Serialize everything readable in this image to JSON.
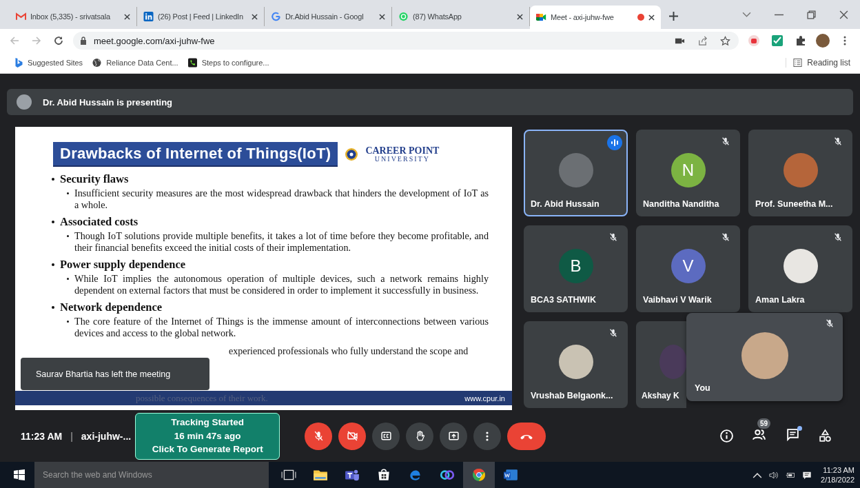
{
  "browser": {
    "tabs": [
      {
        "title": "Inbox (5,335) - srivatsala",
        "selected": false
      },
      {
        "title": "(26) Post | Feed | LinkedIn",
        "selected": false
      },
      {
        "title": "Dr.Abid Hussain - Googl",
        "selected": false
      },
      {
        "title": "(87) WhatsApp",
        "selected": false
      },
      {
        "title": "Meet - axi-juhw-fwe",
        "selected": true,
        "recording": true
      }
    ],
    "url": "meet.google.com/axi-juhw-fwe",
    "bookmarks": [
      {
        "label": "Suggested Sites"
      },
      {
        "label": "Reliance Data Cent..."
      },
      {
        "label": "Steps to configure..."
      }
    ],
    "reading_list": "Reading list"
  },
  "meet": {
    "presenter": "Dr. Abid Hussain is presenting",
    "slide": {
      "title": "Drawbacks of Internet of Things(IoT)",
      "logo": [
        "CAREER POINT",
        "UNIVERSITY"
      ],
      "sections": [
        {
          "heading": "Security flaws",
          "body": "Insufficient security measures are the most widespread drawback that hinders the development of IoT as a whole."
        },
        {
          "heading": "Associated costs",
          "body": "Though IoT solutions provide multiple benefits, it takes a lot of time before they become profitable, and their financial benefits exceed the initial costs of their implementation."
        },
        {
          "heading": "Power supply dependence",
          "body": "While IoT implies the autonomous operation of multiple devices, such a network remains highly dependent on external factors that must be considered in order to implement it successfully in business."
        },
        {
          "heading": "Network dependence",
          "body": "The core feature of the Internet of Things is the immense amount of interconnections between various devices and access to the global network."
        }
      ],
      "tail": "experienced professionals who fully understand the scope and",
      "footer_text": "possible consequences of their work.",
      "url": "www.cpur.in"
    },
    "toast": "Saurav Bhartia has left the meeting",
    "participants": [
      {
        "name": "Dr. Abid Hussain",
        "color": "#6b6f73",
        "speaking": true
      },
      {
        "name": "Nanditha Nanditha",
        "letter": "N",
        "color": "#7cb342",
        "muted": true,
        "speaking": false
      },
      {
        "name": "Prof. Suneetha M...",
        "color": "#b5653a",
        "muted": true,
        "speaking": false
      },
      {
        "name": "BCA3 SATHWIK",
        "letter": "B",
        "color": "#0f5a45",
        "muted": true,
        "speaking": false
      },
      {
        "name": "Vaibhavi V Warik",
        "letter": "V",
        "color": "#5c6bc0",
        "muted": true,
        "speaking": false
      },
      {
        "name": "Aman Lakra",
        "color": "#e8e6e2",
        "muted": true,
        "speaking": false
      },
      {
        "name": "Vrushab Belgaonk...",
        "color": "#c9c2b3",
        "muted": true,
        "speaking": false
      },
      {
        "name": "Akshay K",
        "color": "#4a3a5a",
        "speaking": false
      }
    ],
    "self_view": {
      "label": "You",
      "muted": true
    },
    "time": "11:23 AM",
    "separator": "|",
    "code": "axi-juhw-...",
    "tracking": [
      "Tracking Started",
      "16 min 47s ago",
      "Click To Generate Report"
    ],
    "controls": [
      {
        "kind": "mic",
        "on": false
      },
      {
        "kind": "camera",
        "on": false
      },
      {
        "kind": "captions"
      },
      {
        "kind": "hand"
      },
      {
        "kind": "present"
      },
      {
        "kind": "more"
      },
      {
        "kind": "end"
      }
    ],
    "people_count": "59",
    "chat_unread": true
  },
  "taskbar": {
    "search": {
      "placeholder": "Search the web and Windows"
    },
    "apps": [
      {
        "kind": "taskview",
        "selected": false
      },
      {
        "kind": "explorer",
        "selected": false
      },
      {
        "kind": "teams",
        "selected": false
      },
      {
        "kind": "store",
        "selected": false
      },
      {
        "kind": "edge",
        "selected": false
      },
      {
        "kind": "webex",
        "selected": false
      },
      {
        "kind": "chrome",
        "selected": true
      },
      {
        "kind": "word",
        "selected": false
      }
    ],
    "time": "11:23 AM",
    "date": "2/18/2022"
  }
}
